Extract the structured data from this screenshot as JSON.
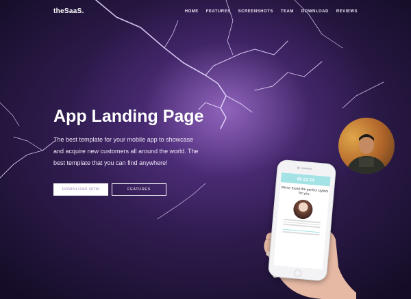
{
  "header": {
    "logo": "theSaaS.",
    "nav": [
      "HOME",
      "FEATURES",
      "SCREENSHOTS",
      "TEAM",
      "DOWNLOAD",
      "REVIEWS"
    ]
  },
  "hero": {
    "title": "App Landing Page",
    "description": "The best template for your mobile app to showcase and acquire new customers all around the world. The best template that you can find anywhere!",
    "download_label": "DOWNLOAD NOW",
    "features_label": "FEATURES"
  },
  "phone_screen": {
    "headline": "We've found the perfect stylists for you."
  },
  "colors": {
    "background_dark": "#140c25",
    "glow": "#a078d7",
    "accent": "#a3e3e6"
  }
}
